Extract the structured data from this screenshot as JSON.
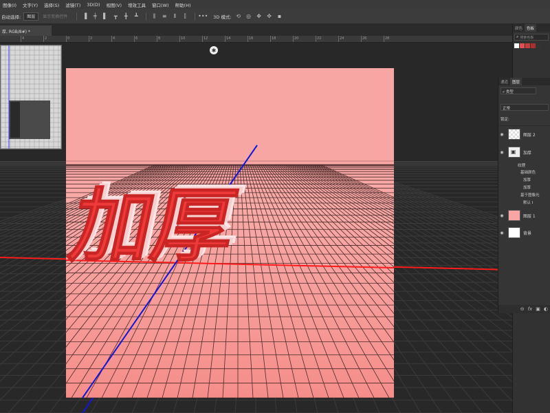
{
  "menu": [
    "图像(I)",
    "文字(Y)",
    "选择(S)",
    "滤镜(T)",
    "3D(D)",
    "视图(V)",
    "增效工具",
    "窗口(W)",
    "帮助(H)"
  ],
  "options": {
    "auto_select_label": "自动选择:",
    "auto_select_value": "图层",
    "transform_controls": "显示变换控件",
    "mode_3d_label": "3D 模式:"
  },
  "doc_tab": "厚, RGB/8#) *",
  "ruler_numbers": [
    "4",
    "2",
    "0",
    "2",
    "4",
    "6",
    "8",
    "10",
    "12",
    "14",
    "16",
    "18",
    "20",
    "22",
    "24",
    "26",
    "28"
  ],
  "canvas": {
    "text": "加厚",
    "colors": {
      "background": "#f8a6a3",
      "text_face": "#ef3a3a",
      "grid": "#3a2a2a",
      "x_axis": "#ff1b1b",
      "y_axis": "#1515d6"
    }
  },
  "dock": {
    "top_tabs": [
      "颜色",
      "色板"
    ],
    "search_placeholder": "搜索色板",
    "swatch_colors": [
      "#ffffff",
      "#e05050",
      "#c43c3c",
      "#a83030",
      "#333333"
    ]
  },
  "layers_panel": {
    "tabs": [
      "通道",
      "图层"
    ],
    "kind_filter": "类型",
    "blend_mode": "正常",
    "lock_label": "锁定:",
    "layers": [
      {
        "name": "图层 2",
        "thumb": "checker"
      },
      {
        "name": "加厚",
        "thumb": "3d"
      },
      {
        "name": "图层 1",
        "thumb": "#f8a6a3"
      },
      {
        "name": "背景",
        "thumb": "#ffffff"
      }
    ],
    "sub_items": [
      "纹理",
      "基础颜色",
      "加厚 ",
      "加厚",
      "基于图像光",
      "默认 I"
    ],
    "footer_icons": [
      "link-icon",
      "fx-icon",
      "mask-icon"
    ]
  }
}
